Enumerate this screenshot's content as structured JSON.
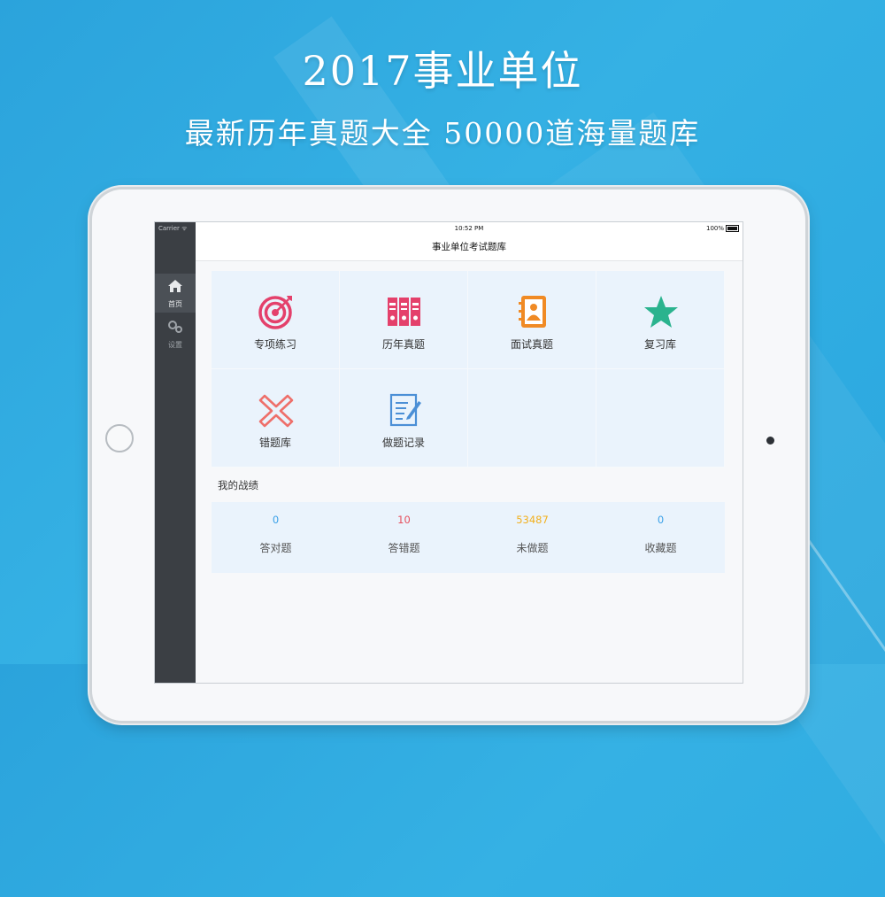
{
  "promo": {
    "headline": "2017事业单位",
    "subline": "最新历年真题大全 50000道海量题库"
  },
  "status_bar": {
    "carrier": "Carrier ᯤ",
    "time": "10:52 PM",
    "battery": "100%"
  },
  "nav": {
    "title": "事业单位考试题库"
  },
  "sidebar": {
    "items": [
      {
        "label": "首页",
        "icon": "home-icon",
        "active": true
      },
      {
        "label": "设置",
        "icon": "gears-icon",
        "active": false
      }
    ]
  },
  "menu": {
    "items": [
      {
        "label": "专项练习",
        "icon": "target-icon",
        "color": "#e4406b"
      },
      {
        "label": "历年真题",
        "icon": "binders-icon",
        "color": "#e4406b"
      },
      {
        "label": "面试真题",
        "icon": "contact-book-icon",
        "color": "#f08a24"
      },
      {
        "label": "复习库",
        "icon": "star-icon",
        "color": "#2ab38e"
      },
      {
        "label": "错题库",
        "icon": "cross-icon",
        "color": "#ee6f6a"
      },
      {
        "label": "做题记录",
        "icon": "notepad-icon",
        "color": "#4b8fd6"
      }
    ]
  },
  "record": {
    "title": "我的战绩",
    "stats": [
      {
        "value": "0",
        "label": "答对题",
        "color": "#3aa0e8"
      },
      {
        "value": "10",
        "label": "答错题",
        "color": "#e6505e"
      },
      {
        "value": "53487",
        "label": "未做题",
        "color": "#f2b01e"
      },
      {
        "value": "0",
        "label": "收藏题",
        "color": "#3aa0e8"
      }
    ]
  }
}
